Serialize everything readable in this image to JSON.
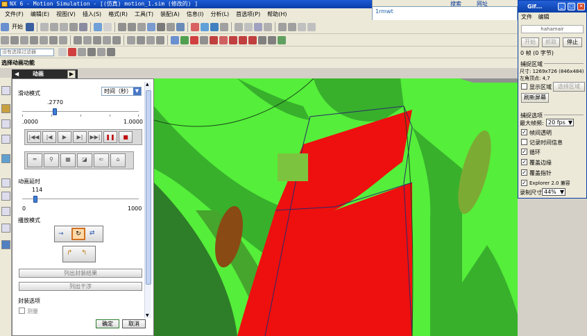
{
  "window": {
    "title": "NX 6 - Motion Simulation - [(仿真) motion_1.sim (修改的) ]"
  },
  "menu": [
    "文件(F)",
    "编辑(E)",
    "视图(V)",
    "插入(S)",
    "格式(R)",
    "工具(T)",
    "装配(A)",
    "信息(I)",
    "分析(L)",
    "首选项(P)",
    "帮助(H)"
  ],
  "toolbar": {
    "start_label": "开始",
    "filter_label": "没有选择过滤器"
  },
  "prompt": "选择动画功能",
  "browser_strip": {
    "search_label": "搜索",
    "url_tab": "网址",
    "address_text": "1rmwt"
  },
  "animation_tab": {
    "title": "动画"
  },
  "animation_panel": {
    "slider_mode_label": "滑动模式",
    "slider_mode_value": "时间（秒）",
    "time_value": ".2770",
    "time_min": ".0000",
    "time_max": "1.0000",
    "time_fraction": 0.277,
    "delay_label": "动画延时",
    "delay_value": "114",
    "delay_min": "0",
    "delay_max": "1000",
    "delay_fraction": 0.114,
    "playback_mode_label": "播放模式",
    "list_button_1": "列出封装结果",
    "list_button_2": "列出干涉",
    "envelope_options_label": "封装选项",
    "collision_label": "测量",
    "ok_label": "确定",
    "cancel_label": "取消"
  },
  "gifcam": {
    "title": "Gif...",
    "menu_file": "文件",
    "menu_edit": "编辑",
    "field_text": "hahamair",
    "btn_start": "开始",
    "btn_capture": "抓取",
    "btn_stop": "停止",
    "frame_info": "0 帧 (0 字节)",
    "capture_area_label": "捕捉区域",
    "size_line": "尺寸: 1269x726 (846x484)",
    "origin_line": "左角顶点:           4,7",
    "show_area_label": "显示区域",
    "select_area_label": "选择区域",
    "refresh_label": "刷新屏幕",
    "capture_options_label": "捕捉选项",
    "max_fps_label": "最大帧频:",
    "max_fps_value": "20 fps",
    "opt_transparent": "帧间透明",
    "opt_record_time": "记录时间信息",
    "opt_loop": "循环",
    "opt_cover_border": "覆盖边缘",
    "opt_cover_pointer": "覆盖指针",
    "opt_ie": "Explorer 2.0 兼容",
    "record_size_label": "录制尺寸",
    "record_size_value": "44%"
  },
  "colors": {
    "bright_green": "#55ee3a",
    "mid_green": "#38b02c",
    "dark_green": "#2e7d28",
    "red": "#ee0f0f",
    "brown": "#8a4a14",
    "olive": "#7cab34"
  }
}
